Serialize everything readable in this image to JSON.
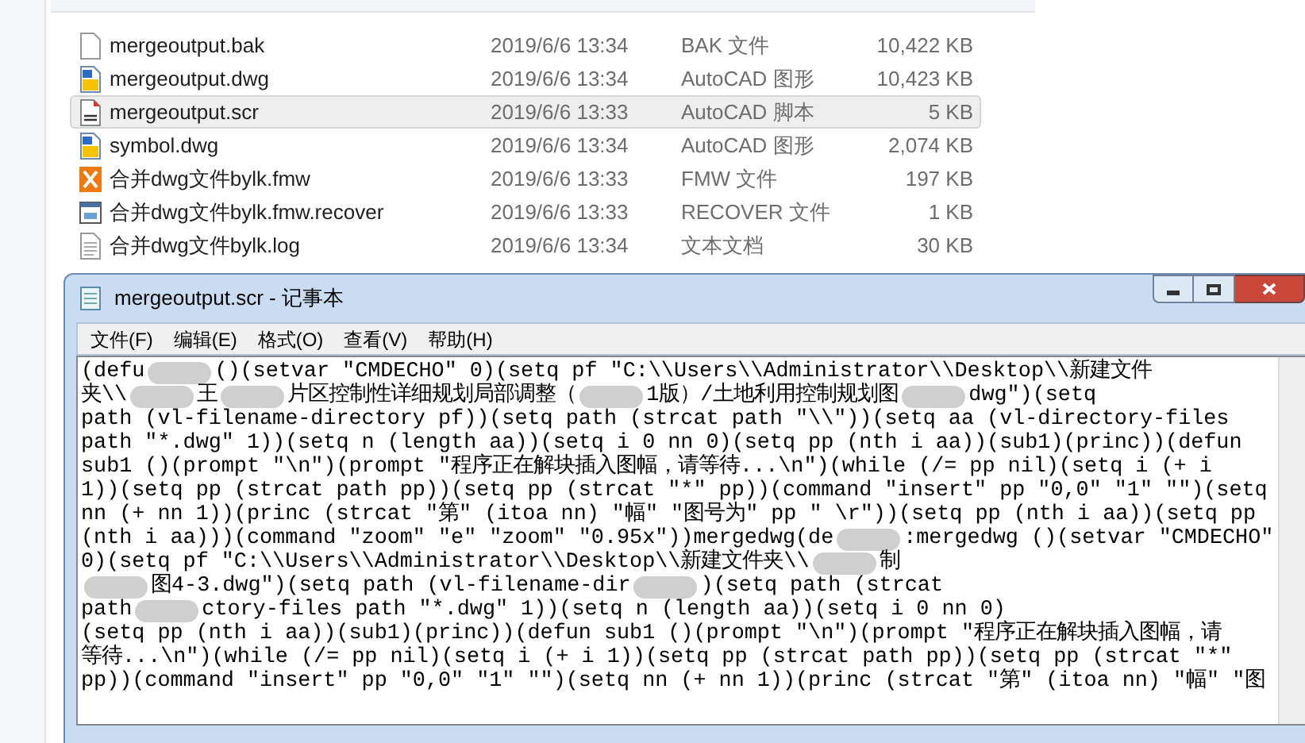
{
  "files": [
    {
      "name": "mergeoutput.bak",
      "modified": "2019/6/6 13:34",
      "type": "BAK 文件",
      "size": "10,422 KB",
      "kind": "blank",
      "selected": false
    },
    {
      "name": "mergeoutput.dwg",
      "modified": "2019/6/6 13:34",
      "type": "AutoCAD 图形",
      "size": "10,423 KB",
      "kind": "dwg",
      "selected": false
    },
    {
      "name": "mergeoutput.scr",
      "modified": "2019/6/6 13:33",
      "type": "AutoCAD 脚本",
      "size": "5 KB",
      "kind": "scr",
      "selected": true
    },
    {
      "name": "symbol.dwg",
      "modified": "2019/6/6 13:34",
      "type": "AutoCAD 图形",
      "size": "2,074 KB",
      "kind": "dwg",
      "selected": false
    },
    {
      "name": "合并dwg文件bylk.fmw",
      "modified": "2019/6/6 13:33",
      "type": "FMW 文件",
      "size": "197 KB",
      "kind": "fmw",
      "selected": false
    },
    {
      "name": "合并dwg文件bylk.fmw.recover",
      "modified": "2019/6/6 13:33",
      "type": "RECOVER 文件",
      "size": "1 KB",
      "kind": "app",
      "selected": false
    },
    {
      "name": "合并dwg文件bylk.log",
      "modified": "2019/6/6 13:34",
      "type": "文本文档",
      "size": "30 KB",
      "kind": "text",
      "selected": false
    }
  ],
  "notepad": {
    "title": "mergeoutput.scr - 记事本",
    "menu": [
      "文件(F)",
      "编辑(E)",
      "格式(O)",
      "查看(V)",
      "帮助(H)"
    ],
    "lines": [
      [
        {
          "kind": "text",
          "text": "(defu"
        },
        {
          "kind": "redacted"
        },
        {
          "kind": "text",
          "text": "()(setvar \"CMDECHO\" 0)(setq pf \"C:\\\\Users\\\\Administrator\\\\Desktop\\\\新建文件"
        }
      ],
      [
        {
          "kind": "text",
          "text": "夹\\\\"
        },
        {
          "kind": "redacted"
        },
        {
          "kind": "text",
          "text": "王"
        },
        {
          "kind": "redacted"
        },
        {
          "kind": "text",
          "text": "片区控制性详细规划局部调整（"
        },
        {
          "kind": "redacted"
        },
        {
          "kind": "text",
          "text": "1版）/土地利用控制规划图"
        },
        {
          "kind": "redacted"
        },
        {
          "kind": "text",
          "text": "dwg\")(setq"
        }
      ],
      [
        {
          "kind": "text",
          "text": "path (vl-filename-directory pf))(setq path (strcat path \"\\\\\"))(setq aa (vl-directory-files"
        }
      ],
      [
        {
          "kind": "text",
          "text": "path \"*.dwg\" 1))(setq n (length aa))(setq i 0 nn 0)(setq pp (nth i aa))(sub1)(princ))(defun"
        }
      ],
      [
        {
          "kind": "text",
          "text": "sub1 ()(prompt \"\\n\")(prompt \"程序正在解块插入图幅，请等待...\\n\")(while (/= pp nil)(setq i (+ i"
        }
      ],
      [
        {
          "kind": "text",
          "text": "1))(setq pp (strcat path pp))(setq pp (strcat \"*\" pp))(command \"insert\" pp \"0,0\" \"1\" \"\")(setq"
        }
      ],
      [
        {
          "kind": "text",
          "text": "nn (+ nn 1))(princ (strcat \"第\" (itoa nn) \"幅\" \"图号为\" pp \" \\r\"))(setq pp (nth i aa))(setq pp"
        }
      ],
      [
        {
          "kind": "text",
          "text": "(nth i aa)))(command \"zoom\" \"e\" \"zoom\" \"0.95x\"))mergedwg(de"
        },
        {
          "kind": "redacted"
        },
        {
          "kind": "text",
          "text": ":mergedwg ()(setvar \"CMDECHO\""
        }
      ],
      [
        {
          "kind": "text",
          "text": "0)(setq pf \"C:\\\\Users\\\\Administrator\\\\Desktop\\\\新建文件夹\\\\"
        },
        {
          "kind": "redacted"
        },
        {
          "kind": "text",
          "text": "制"
        }
      ],
      [
        {
          "kind": "redacted"
        },
        {
          "kind": "text",
          "text": "图4-3.dwg\")(setq path (vl-filename-dir"
        },
        {
          "kind": "redacted"
        },
        {
          "kind": "text",
          "text": ")(setq path (strcat"
        }
      ],
      [
        {
          "kind": "text",
          "text": "path"
        },
        {
          "kind": "redacted"
        },
        {
          "kind": "text",
          "text": "ctory-files path \"*.dwg\" 1))(setq n (length aa))(setq i 0 nn 0)"
        }
      ],
      [
        {
          "kind": "text",
          "text": "(setq pp (nth i aa))(sub1)(princ))(defun sub1 ()(prompt \"\\n\")(prompt \"程序正在解块插入图幅，请"
        }
      ],
      [
        {
          "kind": "text",
          "text": "等待...\\n\")(while (/= pp nil)(setq i (+ i 1))(setq pp (strcat path pp))(setq pp (strcat \"*\""
        }
      ],
      [
        {
          "kind": "text",
          "text": "pp))(command \"insert\" pp \"0,0\" \"1\" \"\")(setq nn (+ nn 1))(princ (strcat \"第\" (itoa nn) \"幅\" \"图"
        }
      ]
    ]
  }
}
